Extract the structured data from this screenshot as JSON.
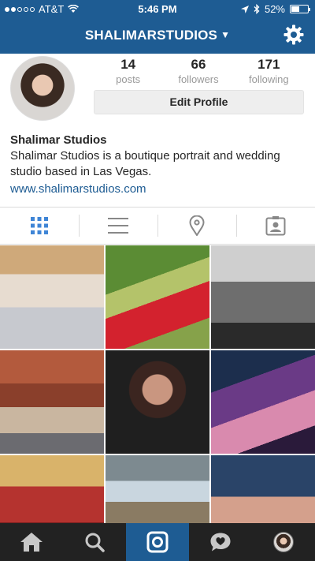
{
  "status_bar": {
    "carrier": "AT&T",
    "signal_bars_filled": 2,
    "signal_bars_total": 5,
    "time": "5:46 PM",
    "battery": "52%",
    "battery_level": 0.52
  },
  "nav": {
    "username": "SHALIMARSTUDIOS",
    "dropdown_icon": "chevron-down-icon",
    "settings_icon": "gear-icon"
  },
  "profile": {
    "posts_count": "14",
    "posts_label": "posts",
    "followers_count": "66",
    "followers_label": "followers",
    "following_count": "171",
    "following_label": "following",
    "edit_button": "Edit Profile"
  },
  "bio": {
    "name": "Shalimar Studios",
    "description": "Shalimar Studios is a boutique portrait and wedding studio based in Las Vegas.",
    "url": "www.shalimarstudios.com"
  },
  "tabs": [
    {
      "icon": "grid-icon",
      "active": true
    },
    {
      "icon": "list-icon",
      "active": false
    },
    {
      "icon": "location-pin-icon",
      "active": false
    },
    {
      "icon": "tagged-photos-icon",
      "active": false
    }
  ],
  "bottom_tabs": [
    {
      "icon": "home-icon"
    },
    {
      "icon": "search-icon"
    },
    {
      "icon": "camera-icon",
      "active": true
    },
    {
      "icon": "activity-heart-icon"
    },
    {
      "icon": "profile-avatar-icon"
    }
  ],
  "colors": {
    "brand_blue": "#1e5c93",
    "tab_active": "#3f85d6",
    "tab_inactive": "#888888",
    "bottom_bar": "#222222"
  }
}
